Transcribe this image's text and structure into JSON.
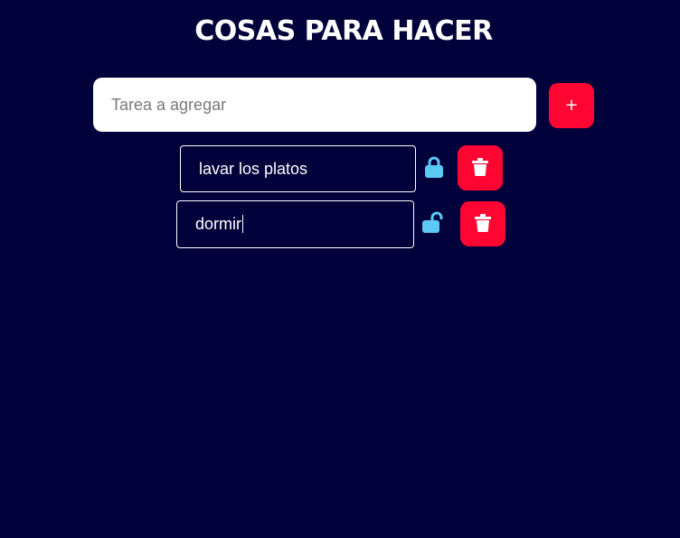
{
  "header": {
    "title": "COSAS PARA HACER"
  },
  "new_task": {
    "placeholder": "Tarea a agregar",
    "value": "",
    "add_label": "+"
  },
  "tasks": [
    {
      "text": "lavar los platos",
      "locked": true,
      "lock_icon": "lock-closed-icon",
      "delete_icon": "trash-icon"
    },
    {
      "text": "dormir",
      "locked": false,
      "lock_icon": "lock-open-icon",
      "delete_icon": "trash-icon"
    }
  ],
  "colors": {
    "background": "#00003b",
    "accent_red": "#ff0532",
    "lock_blue": "#5ec8f5",
    "text_white": "#ffffff"
  }
}
